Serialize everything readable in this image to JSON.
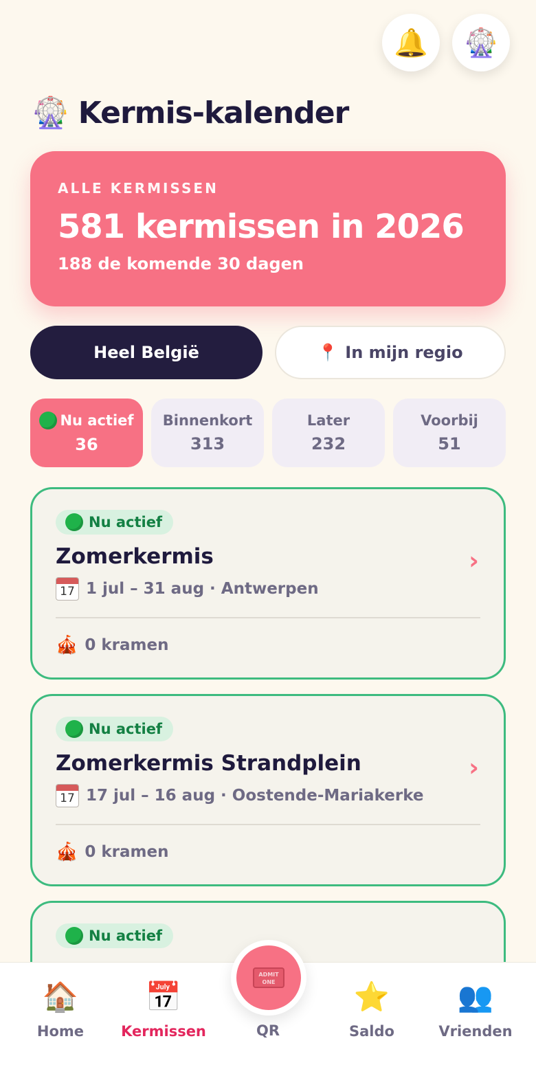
{
  "header": {
    "title": "Kermis-kalender",
    "title_icon": "ferris-wheel-icon",
    "buttons": [
      {
        "name": "notifications",
        "icon": "bell-icon"
      },
      {
        "name": "profile",
        "icon": "ferris-wheel-icon"
      }
    ]
  },
  "hero": {
    "eyebrow": "ALLE KERMISSEN",
    "headline": "581 kermissen in 2026",
    "subline": "188 de komende 30 dagen"
  },
  "scope": {
    "all_label": "Heel België",
    "region_label": "In mijn regio",
    "region_icon": "pin-icon"
  },
  "filters": [
    {
      "label": "Nu actief",
      "count": "36",
      "active": true
    },
    {
      "label": "Binnenkort",
      "count": "313"
    },
    {
      "label": "Later",
      "count": "232"
    },
    {
      "label": "Voorbij",
      "count": "51"
    }
  ],
  "events": [
    {
      "status": "Nu actief",
      "name": "Zomerkermis",
      "dates_location": "1 jul – 31 aug · Antwerpen",
      "stalls": "0 kramen"
    },
    {
      "status": "Nu actief",
      "name": "Zomerkermis Strandplein",
      "dates_location": "17 jul – 16 aug · Oostende-Mariakerke",
      "stalls": "0 kramen"
    },
    {
      "status": "Nu actief"
    }
  ],
  "calendar_icon_day": "17",
  "nav": {
    "home": "Home",
    "kermissen": "Kermissen",
    "qr": "QR",
    "saldo": "Saldo",
    "vrienden": "Vrienden",
    "ticket_text": "ADMIT ONE"
  },
  "colors": {
    "accent": "#f77184",
    "dark": "#231d3f",
    "active_green": "#3dbb7f",
    "nav_active": "#e3265d",
    "background": "#fdf8ee"
  }
}
